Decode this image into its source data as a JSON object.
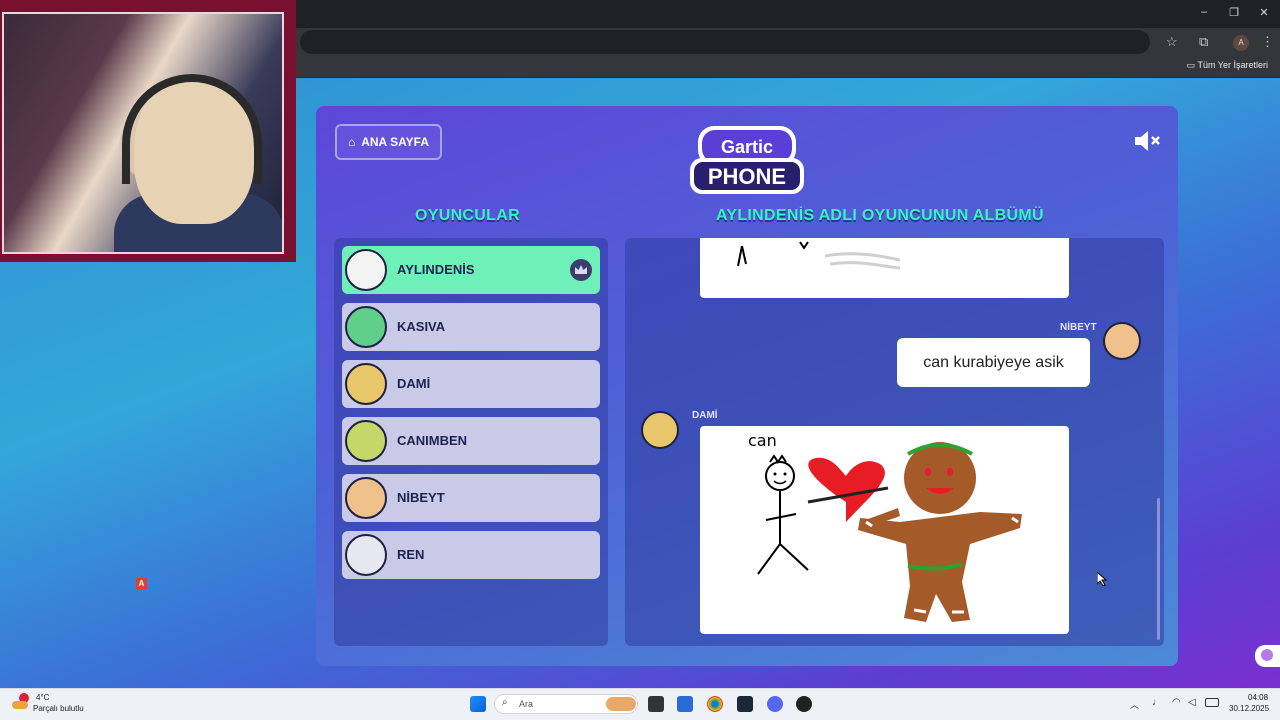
{
  "browser": {
    "bookmarks_label": "Tüm Yer İşaretleri",
    "profile_initial": "A"
  },
  "game": {
    "home_button": "ANA SAYFA",
    "logo_top": "Gartic",
    "logo_bottom": "PHONE",
    "players_title": "OYUNCULAR",
    "album_title": "AYLINDENİS ADLI OYUNCUNUN ALBÜMÜ",
    "players": [
      {
        "name": "AYLINDENİS",
        "active": true
      },
      {
        "name": "KASIVA",
        "active": false
      },
      {
        "name": "DAMİ",
        "active": false
      },
      {
        "name": "CANIMBEN",
        "active": false
      },
      {
        "name": "NİBEYT",
        "active": false
      },
      {
        "name": "REN",
        "active": false
      }
    ],
    "album": {
      "msg1_author": "NİBEYT",
      "msg1_text": "can kurabiyeye asik",
      "msg2_author": "DAMİ",
      "drawing_caption": "can"
    }
  },
  "overlay": {
    "stream_marker": "A"
  },
  "taskbar": {
    "weather_temp": "4°C",
    "weather_desc": "Parçalı bulutlu",
    "search_placeholder": "Ara",
    "time": "04:08",
    "date": "30.12.2025"
  }
}
